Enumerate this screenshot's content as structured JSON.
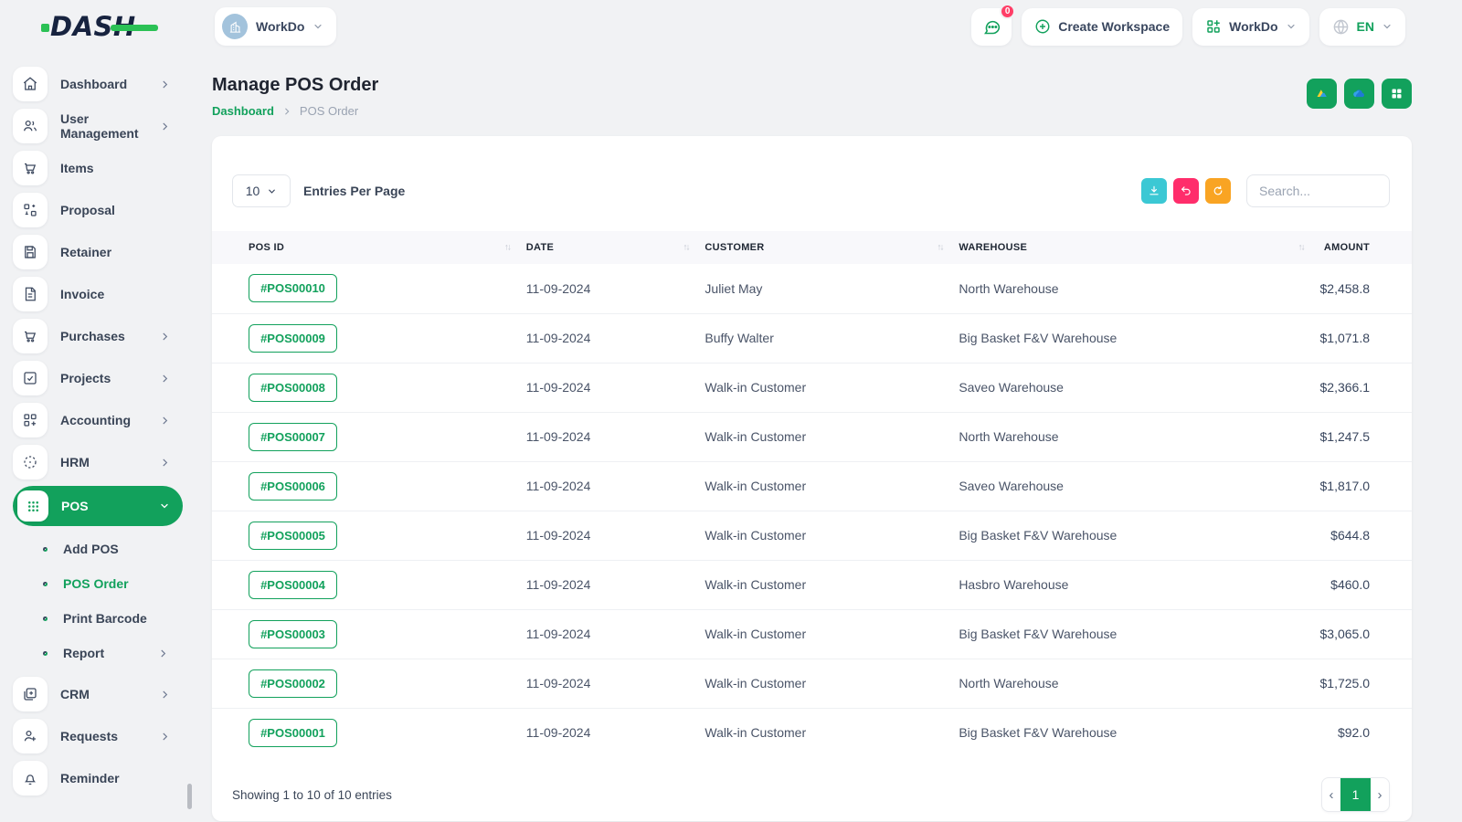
{
  "colors": {
    "primary": "#12a15c",
    "logo_green": "#2bc155",
    "teal": "#3bc8d4",
    "pink": "#ff2d6b",
    "orange": "#f9a423",
    "badge_pink": "#ff3e67",
    "page_bg": "#f1f2f4"
  },
  "brand": {
    "logo_text": "DASH"
  },
  "topbar": {
    "workspace_label": "WorkDo",
    "chat_badge": "0",
    "create_workspace_label": "Create Workspace",
    "workdo_menu_label": "WorkDo",
    "language": "EN"
  },
  "sidebar": {
    "items": [
      {
        "label": "Dashboard"
      },
      {
        "label": "User Management"
      },
      {
        "label": "Items"
      },
      {
        "label": "Proposal"
      },
      {
        "label": "Retainer"
      },
      {
        "label": "Invoice"
      },
      {
        "label": "Purchases"
      },
      {
        "label": "Projects"
      },
      {
        "label": "Accounting"
      },
      {
        "label": "HRM"
      },
      {
        "label": "POS"
      },
      {
        "label": "CRM"
      },
      {
        "label": "Requests"
      },
      {
        "label": "Reminder"
      }
    ],
    "pos_children": [
      {
        "label": "Add POS"
      },
      {
        "label": "POS Order"
      },
      {
        "label": "Print Barcode"
      },
      {
        "label": "Report"
      }
    ]
  },
  "page": {
    "title": "Manage POS Order",
    "breadcrumb_home": "Dashboard",
    "breadcrumb_current": "POS Order"
  },
  "controls": {
    "entries_value": "10",
    "entries_label": "Entries Per Page",
    "search_placeholder": "Search..."
  },
  "table": {
    "headers": [
      "POS ID",
      "DATE",
      "CUSTOMER",
      "WAREHOUSE",
      "AMOUNT"
    ],
    "sort_glyph": "↑↓",
    "rows": [
      {
        "id": "#POS00010",
        "date": "11-09-2024",
        "customer": "Juliet May",
        "warehouse": "North Warehouse",
        "amount": "$2,458.8"
      },
      {
        "id": "#POS00009",
        "date": "11-09-2024",
        "customer": "Buffy Walter",
        "warehouse": "Big Basket F&V Warehouse",
        "amount": "$1,071.8"
      },
      {
        "id": "#POS00008",
        "date": "11-09-2024",
        "customer": "Walk-in Customer",
        "warehouse": "Saveo Warehouse",
        "amount": "$2,366.1"
      },
      {
        "id": "#POS00007",
        "date": "11-09-2024",
        "customer": "Walk-in Customer",
        "warehouse": "North Warehouse",
        "amount": "$1,247.5"
      },
      {
        "id": "#POS00006",
        "date": "11-09-2024",
        "customer": "Walk-in Customer",
        "warehouse": "Saveo Warehouse",
        "amount": "$1,817.0"
      },
      {
        "id": "#POS00005",
        "date": "11-09-2024",
        "customer": "Walk-in Customer",
        "warehouse": "Big Basket F&V Warehouse",
        "amount": "$644.8"
      },
      {
        "id": "#POS00004",
        "date": "11-09-2024",
        "customer": "Walk-in Customer",
        "warehouse": "Hasbro Warehouse",
        "amount": "$460.0"
      },
      {
        "id": "#POS00003",
        "date": "11-09-2024",
        "customer": "Walk-in Customer",
        "warehouse": "Big Basket F&V Warehouse",
        "amount": "$3,065.0"
      },
      {
        "id": "#POS00002",
        "date": "11-09-2024",
        "customer": "Walk-in Customer",
        "warehouse": "North Warehouse",
        "amount": "$1,725.0"
      },
      {
        "id": "#POS00001",
        "date": "11-09-2024",
        "customer": "Walk-in Customer",
        "warehouse": "Big Basket F&V Warehouse",
        "amount": "$92.0"
      }
    ]
  },
  "footer": {
    "showing": "Showing 1 to 10 of 10 entries",
    "prev": "‹",
    "page": "1",
    "next": "›"
  }
}
